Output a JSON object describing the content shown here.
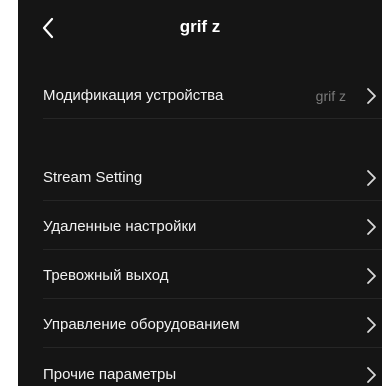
{
  "header": {
    "title": "grif z",
    "back_icon": "chevron-left-icon"
  },
  "rows": [
    {
      "label": "Модификация устройства",
      "value": "grif z",
      "icon": "chevron-right-icon"
    },
    {
      "label": "Stream Setting",
      "icon": "chevron-right-icon"
    },
    {
      "label": "Удаленные настройки",
      "icon": "chevron-right-icon"
    },
    {
      "label": "Тревожный выход",
      "icon": "chevron-right-icon"
    },
    {
      "label": "Управление оборудованием",
      "icon": "chevron-right-icon"
    },
    {
      "label": "Прочие параметры",
      "icon": "chevron-right-icon"
    }
  ],
  "colors": {
    "background": "#151515",
    "text": "#f2f2f2",
    "secondary_text": "#7a7a7a",
    "separator": "#262626"
  }
}
